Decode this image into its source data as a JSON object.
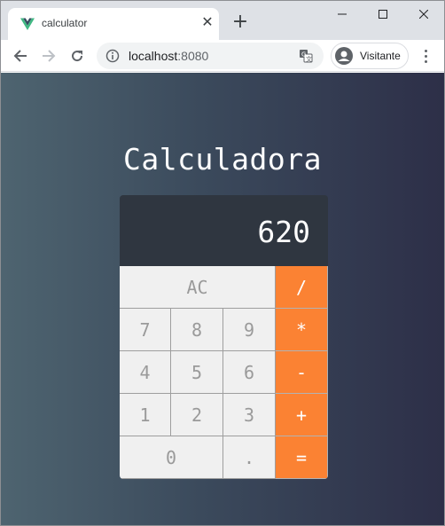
{
  "browser": {
    "tab_title": "calculator",
    "url_host": "localhost",
    "url_port": ":8080",
    "profile_name": "Visitante"
  },
  "app": {
    "title": "Calculadora",
    "display": "620"
  },
  "keys": {
    "ac": "AC",
    "divide": "/",
    "seven": "7",
    "eight": "8",
    "nine": "9",
    "multiply": "*",
    "four": "4",
    "five": "5",
    "six": "6",
    "minus": "-",
    "one": "1",
    "two": "2",
    "three": "3",
    "plus": "+",
    "zero": "0",
    "dot": ".",
    "equals": "="
  },
  "colors": {
    "operator": "#fb8233",
    "key": "#f0f0f0",
    "display": "#2f3640",
    "vue_green": "#41b883",
    "vue_dark": "#34495e"
  }
}
